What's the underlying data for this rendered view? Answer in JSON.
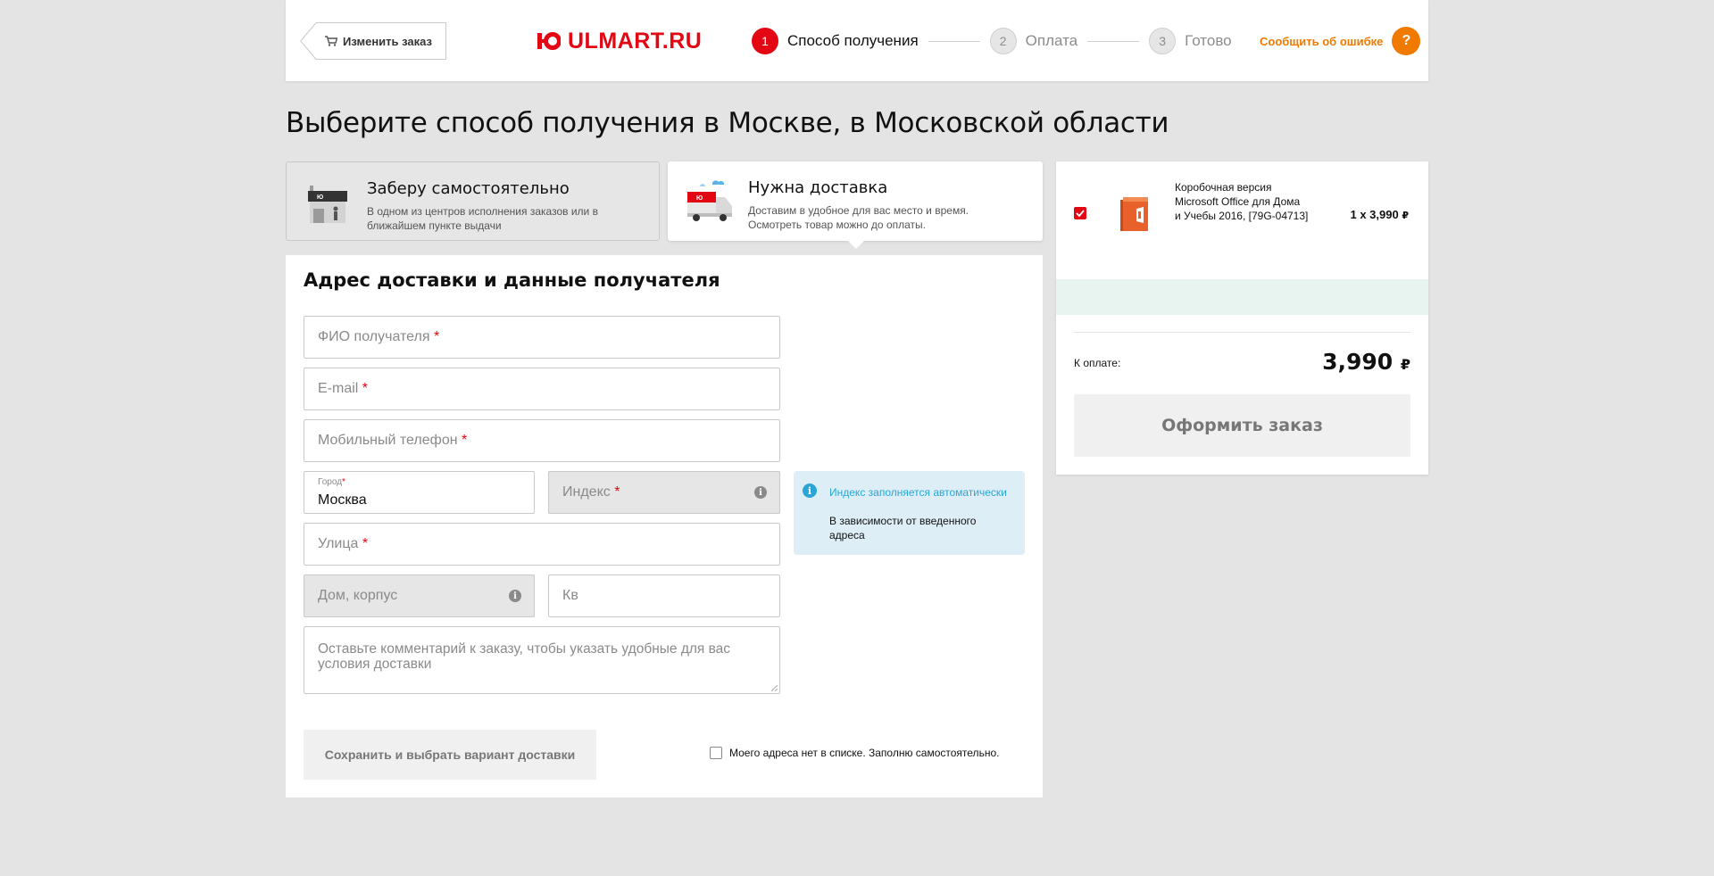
{
  "header": {
    "back_label": "Изменить заказ",
    "logo_text": "ULMART.RU",
    "steps": [
      {
        "num": "1",
        "label": "Способ получения"
      },
      {
        "num": "2",
        "label": "Оплата"
      },
      {
        "num": "3",
        "label": "Готово"
      }
    ],
    "active_step": 1,
    "report_label": "Сообщить об ошибке",
    "report_icon": "?"
  },
  "page_title": "Выберите способ получения в Москве, в Московской области",
  "tabs": {
    "pickup": {
      "title": "Заберу самостоятельно",
      "desc": "В одном из центров исполнения заказов или в ближайшем пункте выдачи",
      "icon": "store-icon"
    },
    "delivery": {
      "title": "Нужна доставка",
      "desc": "Доставим в удобное для вас место и время. Осмотреть товар можно до оплаты.",
      "icon": "delivery-truck-icon",
      "selected": true
    }
  },
  "form": {
    "title": "Адрес доставки и данные получателя",
    "fullname_placeholder": "ФИО получателя",
    "email_placeholder": "E-mail",
    "phone_placeholder": "Мобильный телефон",
    "city_label": "Город",
    "city_value": "Москва",
    "index_placeholder": "Индекс",
    "street_placeholder": "Улица",
    "house_placeholder": "Дом, корпус",
    "apt_placeholder": "Кв",
    "comment_placeholder": "Оставьте комментарий к заказу, чтобы указать удобные для вас условия доставки",
    "required_mark": "*",
    "info_glyph": "i",
    "hint_title": "Индекс заполняется автоматически",
    "hint_text": "В зависимости от введенного адреса",
    "save_label": "Сохранить и выбрать вариант доставки",
    "manual_label": "Моего адреса нет в списке. Заполню самостоятельно.",
    "manual_checked": false
  },
  "summary": {
    "item": {
      "name": "Коробочная версия Microsoft Office для Дома и Учебы 2016, [79G-04713]",
      "quantity_price": "1 x 3,990",
      "checked": true
    },
    "currency": "₽",
    "total_label": "К оплате:",
    "total_value": "3,990",
    "checkout_label": "Оформить заказ"
  },
  "colors": {
    "brand_red": "#e30613",
    "accent_orange": "#f07a00",
    "hint_blue": "#2aa6d6",
    "hint_bg": "#ddeef6",
    "page_bg": "#e4e4e4"
  }
}
